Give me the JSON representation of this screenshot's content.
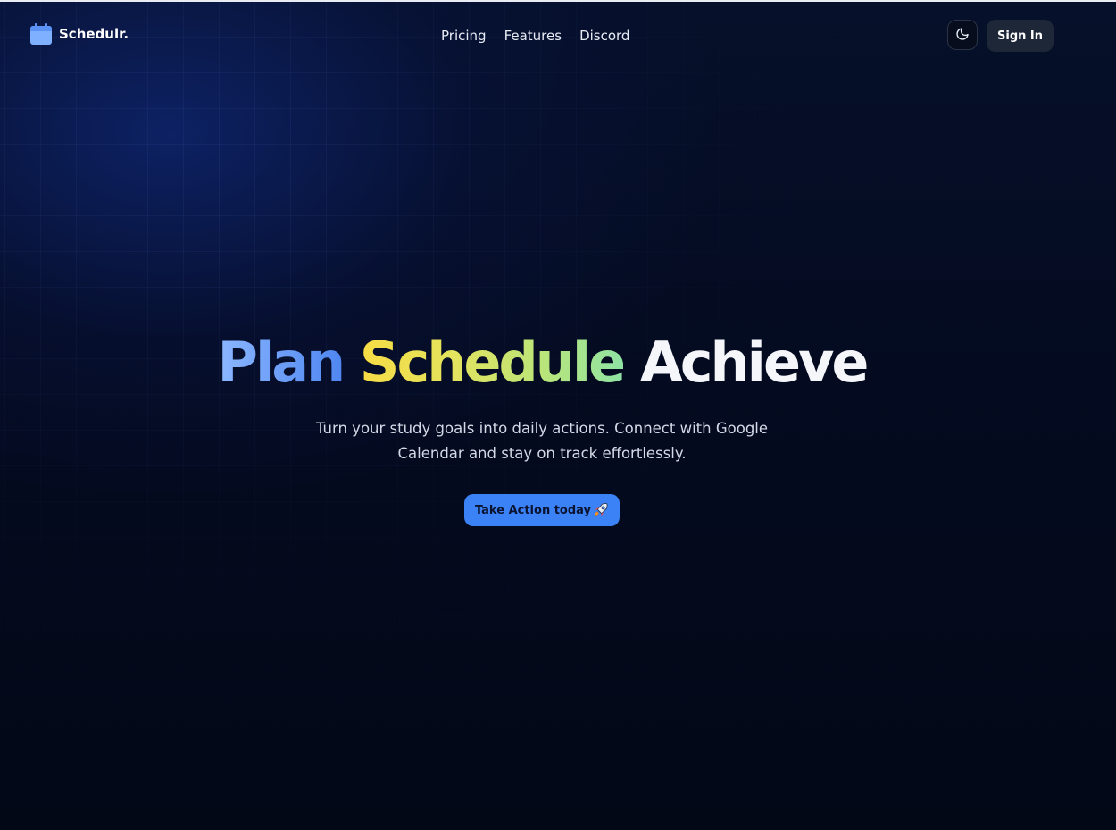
{
  "brand": {
    "name": "Schedulr.",
    "logo_icon": "calendar-icon",
    "accent_color": "#3b82f6"
  },
  "nav": {
    "items": [
      {
        "label": "Pricing"
      },
      {
        "label": "Features"
      },
      {
        "label": "Discord"
      }
    ]
  },
  "header": {
    "theme_toggle_icon": "moon-icon",
    "signin_label": "Sign In"
  },
  "hero": {
    "title_words": [
      "Plan",
      "Schedule",
      "Achieve"
    ],
    "subtitle": "Turn your study goals into daily actions. Connect with Google Calendar and stay on track effortlessly.",
    "cta_label": "Take Action today",
    "cta_icon": "rocket-icon"
  }
}
